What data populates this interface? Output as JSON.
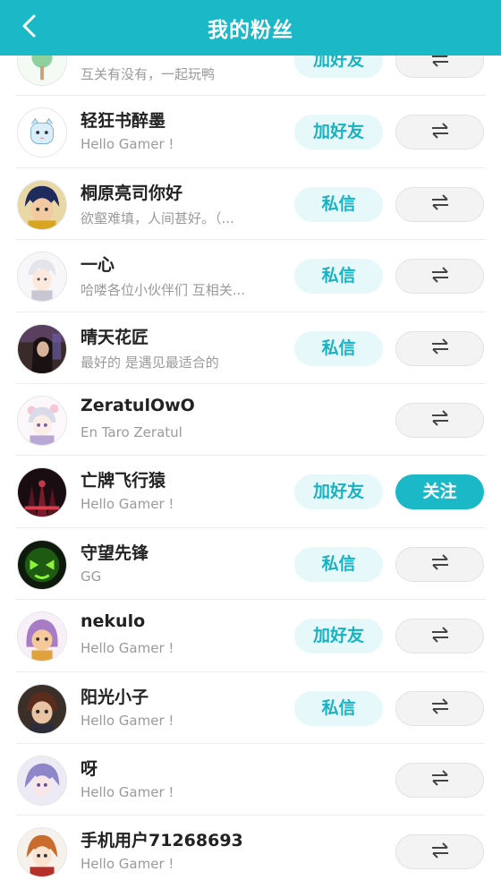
{
  "header": {
    "title": "我的粉丝",
    "back_icon": "chevron-left-icon"
  },
  "colors": {
    "accent": "#1bb9c8",
    "action_bg": "#e7f8fa",
    "action_text": "#17b3c2",
    "swap_bg": "#f3f3f3"
  },
  "fans": [
    {
      "name": "",
      "sub": "互关有没有，一起玩鸭",
      "action": "加好友",
      "right": "swap-icon"
    },
    {
      "name": "轻狂书醉墨",
      "sub": "Hello Gamer !",
      "action": "加好友",
      "right": "swap-icon"
    },
    {
      "name": "桐原亮司你好",
      "sub": "欲壑难填，人间甚好。（...",
      "action": "私信",
      "right": "swap-icon"
    },
    {
      "name": "一心",
      "sub": "哈喽各位小伙伴们 互相关...",
      "action": "私信",
      "right": "swap-icon"
    },
    {
      "name": "晴天花匠",
      "sub": "最好的 是遇见最适合的",
      "action": "私信",
      "right": "swap-icon"
    },
    {
      "name": "ZeratulOwO",
      "sub": "En Taro Zeratul",
      "action": "",
      "right": "swap-icon"
    },
    {
      "name": "亡牌飞行猿",
      "sub": "Hello Gamer !",
      "action": "加好友",
      "right": "关注"
    },
    {
      "name": "守望先锋",
      "sub": "GG",
      "action": "私信",
      "right": "swap-icon"
    },
    {
      "name": "nekulo",
      "sub": "Hello Gamer !",
      "action": "加好友",
      "right": "swap-icon"
    },
    {
      "name": "阳光小子",
      "sub": "Hello Gamer !",
      "action": "私信",
      "right": "swap-icon"
    },
    {
      "name": "呀",
      "sub": "Hello Gamer !",
      "action": "",
      "right": "swap-icon"
    },
    {
      "name": "手机用户71268693",
      "sub": "Hello Gamer !",
      "action": "",
      "right": "swap-icon"
    }
  ]
}
